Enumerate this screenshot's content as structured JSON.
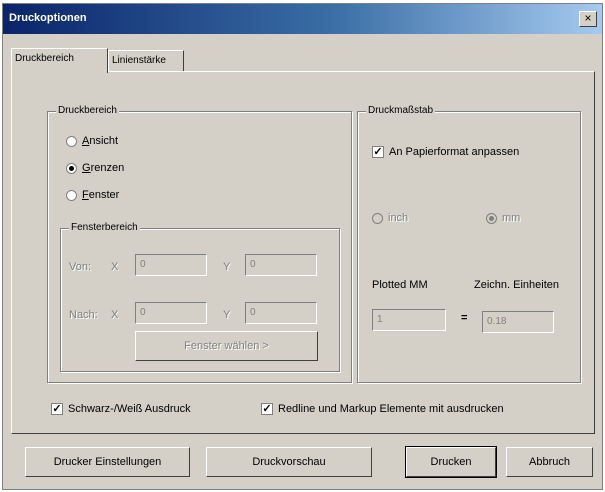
{
  "window": {
    "title": "Druckoptionen",
    "close_glyph": "×"
  },
  "tabs": [
    {
      "label": "Druckbereich"
    },
    {
      "label": "Linienstärke"
    }
  ],
  "print_area": {
    "title": "Druckbereich",
    "options": [
      {
        "label": "Ansicht",
        "selected": false
      },
      {
        "label": "Grenzen",
        "selected": true
      },
      {
        "label": "Fenster",
        "selected": false
      }
    ],
    "window_area": {
      "title": "Fensterbereich",
      "from_label": "Von:",
      "to_label": "Nach:",
      "x_label": "X",
      "y_label": "Y",
      "from_x": "0",
      "from_y": "0",
      "to_x": "0",
      "to_y": "0",
      "select_button": "Fenster wählen >"
    }
  },
  "print_scale": {
    "title": "Druckmaßstab",
    "fit_to_paper": {
      "label": "An Papierformat anpassen",
      "checked": true
    },
    "units": [
      {
        "label": "inch",
        "selected": false
      },
      {
        "label": "mm",
        "selected": true
      }
    ],
    "plotted_label": "Plotted MM",
    "drawing_label": "Zeichn. Einheiten",
    "plotted_value": "1",
    "equals": "=",
    "drawing_value": "0.18"
  },
  "options": {
    "black_white": {
      "label": "Schwarz-/Weiß Ausdruck",
      "checked": true
    },
    "redline": {
      "label": "Redline und Markup Elemente mit ausdrucken",
      "checked": true
    }
  },
  "buttons": {
    "printer_settings": "Drucker Einstellungen",
    "preview": "Druckvorschau",
    "print": "Drucken",
    "cancel": "Abbruch"
  },
  "icons": {
    "check": "✓"
  }
}
